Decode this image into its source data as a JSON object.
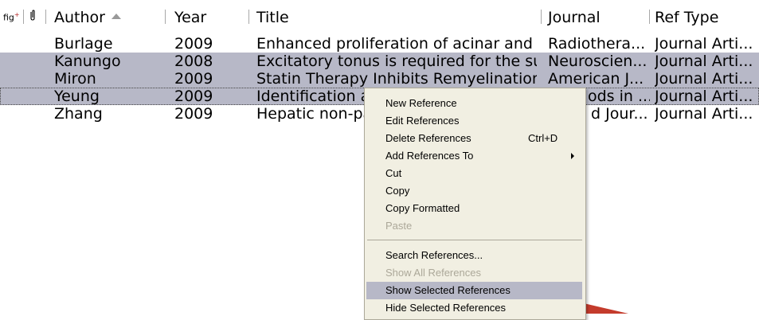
{
  "header": {
    "figure_icon": "fig",
    "figure_icon_sup": "+",
    "attachment_icon": "paperclip-icon",
    "columns": [
      "Author",
      "Year",
      "Title",
      "Journal",
      "Ref Type"
    ],
    "sort_indicator": "ascending"
  },
  "rows": [
    {
      "author": "Burlage",
      "year": "2009",
      "title": "Enhanced proliferation of acinar and ...",
      "journal": "Radiothera...",
      "reftype": "Journal Arti...",
      "selected": false
    },
    {
      "author": "Kanungo",
      "year": "2008",
      "title": "Excitatory tonus is required for the su...",
      "journal": "Neuroscien...",
      "reftype": "Journal Arti...",
      "selected": true
    },
    {
      "author": "Miron",
      "year": "2009",
      "title": "Statin Therapy Inhibits Remyelination...",
      "journal": "American J...",
      "reftype": "Journal Arti...",
      "selected": true
    },
    {
      "author": "Yeung",
      "year": "2009",
      "title": "Identification ar",
      "journal": "ods in ...",
      "reftype": "Journal Arti...",
      "selected": true
    },
    {
      "author": "Zhang",
      "year": "2009",
      "title": "Hepatic non-pa",
      "journal": "d Jour...",
      "reftype": "Journal Arti...",
      "selected": false
    }
  ],
  "context_menu": {
    "items": [
      {
        "label": "New Reference"
      },
      {
        "label": "Edit References"
      },
      {
        "label": "Delete References",
        "shortcut": "Ctrl+D"
      },
      {
        "label": "Add References To",
        "submenu": true
      },
      {
        "label": "Cut"
      },
      {
        "label": "Copy"
      },
      {
        "label": "Copy Formatted"
      },
      {
        "label": "Paste",
        "disabled": true
      },
      {
        "label": "Search References..."
      },
      {
        "label": "Show All References",
        "disabled": true
      },
      {
        "label": "Show Selected References",
        "highlighted": true
      },
      {
        "label": "Hide Selected References"
      }
    ]
  },
  "colors": {
    "selection": "#b7b8c7",
    "menu_bg": "#f1efe2",
    "disabled_text": "#aca899"
  }
}
